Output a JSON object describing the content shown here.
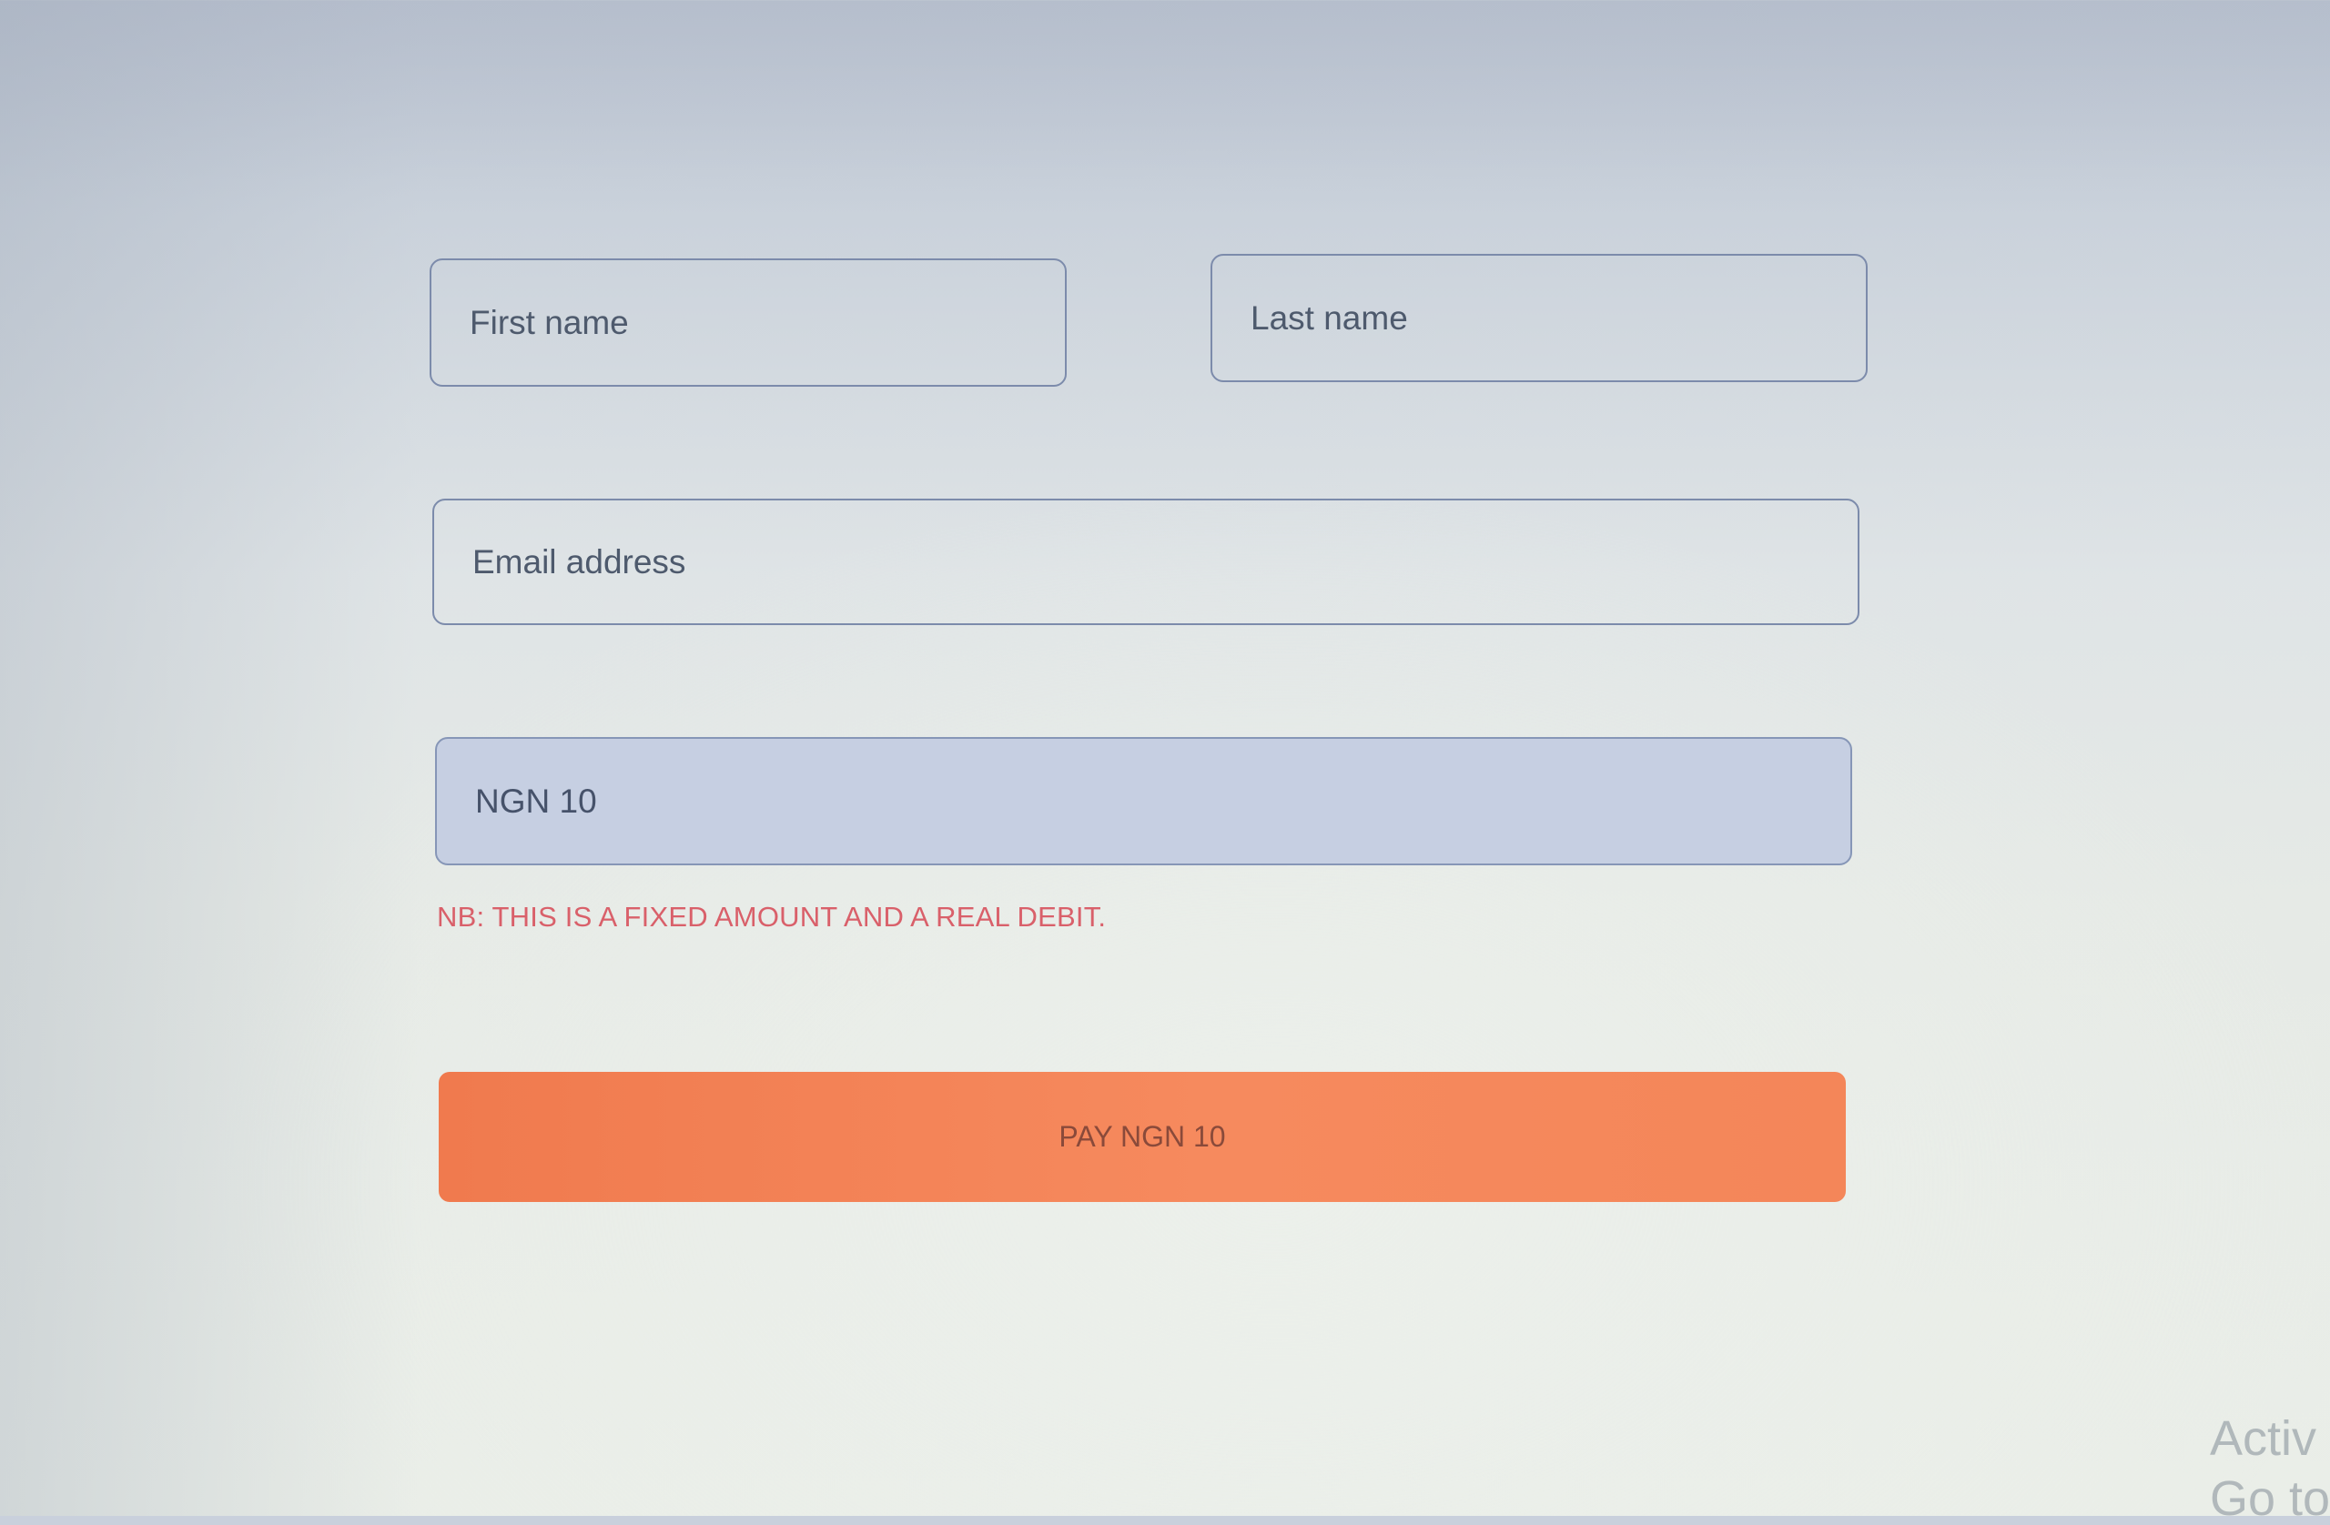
{
  "form": {
    "first_name_placeholder": "First name",
    "last_name_placeholder": "Last name",
    "email_placeholder": "Email address",
    "amount_display": "NGN 10",
    "notice": "NB: THIS IS A FIXED AMOUNT AND A REAL DEBIT.",
    "pay_button_label": "PAY NGN 10"
  },
  "watermark": {
    "line1": "Activ",
    "line2": "Go to"
  },
  "colors": {
    "accent": "#f48659",
    "notice": "#d9606a",
    "amount_bg": "#c6cfe2"
  }
}
